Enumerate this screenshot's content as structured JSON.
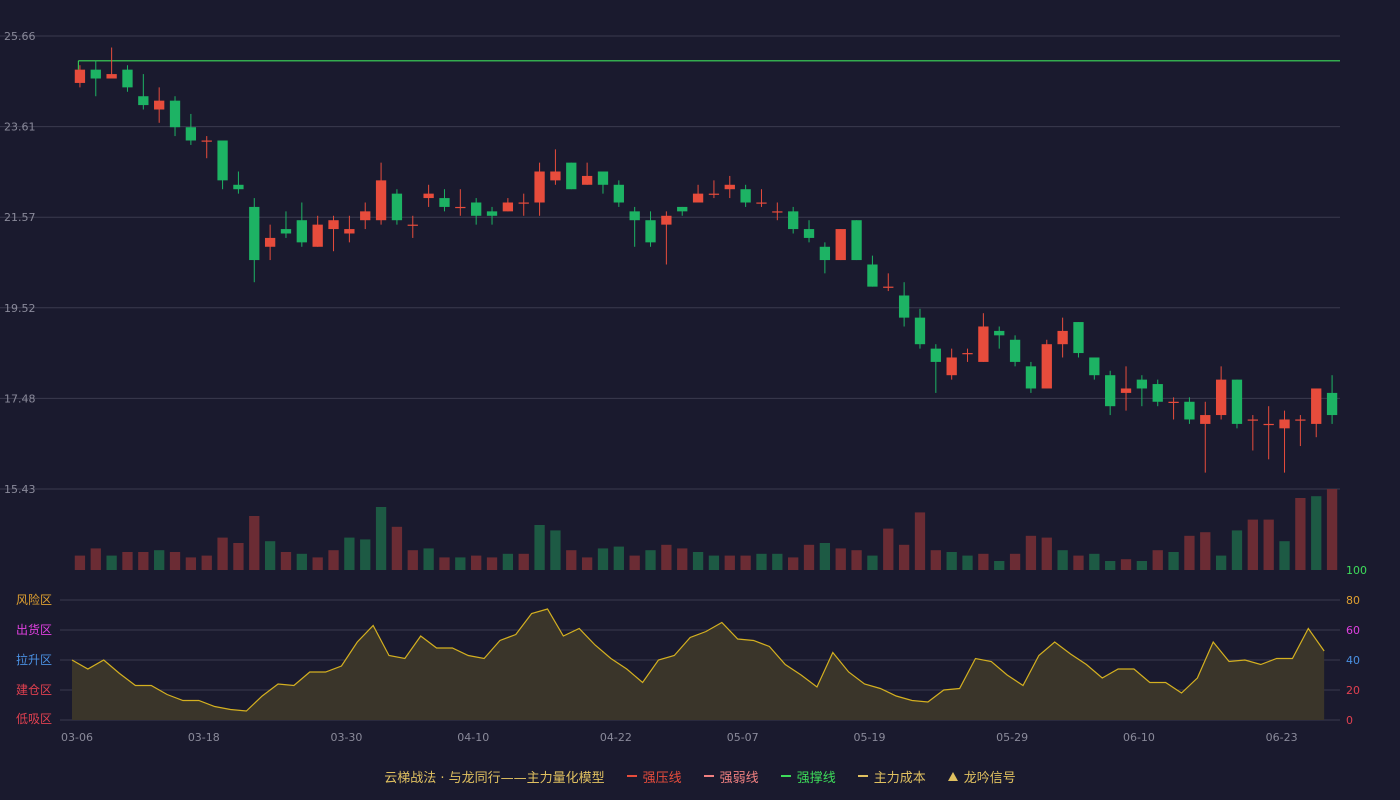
{
  "chart_data": [
    {
      "type": "candlestick",
      "title": "",
      "x_tick_labels": [
        "03-06",
        "03-18",
        "03-30",
        "04-10",
        "04-22",
        "05-07",
        "05-19",
        "05-29",
        "06-10",
        "06-23"
      ],
      "y_tick_labels": [
        "25.66",
        "23.61",
        "21.57",
        "19.52",
        "17.48",
        "15.43"
      ],
      "ylim": [
        15.43,
        25.66
      ],
      "resistance_line": 25.1,
      "colors": {
        "up": "#e74c3c",
        "down": "#1db364",
        "resistance": "#3ddc5a",
        "background": "#1a1a2e",
        "grid": "#3a3a4e"
      },
      "candles": [
        [
          24.6,
          24.9,
          25.0,
          24.5
        ],
        [
          24.9,
          24.7,
          25.1,
          24.3
        ],
        [
          24.7,
          24.8,
          25.4,
          24.7
        ],
        [
          24.9,
          24.5,
          25.0,
          24.4
        ],
        [
          24.3,
          24.1,
          24.8,
          24.0
        ],
        [
          24.0,
          24.2,
          24.5,
          23.7
        ],
        [
          24.2,
          23.6,
          24.3,
          23.4
        ],
        [
          23.6,
          23.3,
          23.9,
          23.2
        ],
        [
          23.3,
          23.3,
          23.4,
          22.9
        ],
        [
          23.3,
          22.4,
          23.3,
          22.2
        ],
        [
          22.3,
          22.2,
          22.6,
          22.1
        ],
        [
          21.8,
          20.6,
          22.0,
          20.1
        ],
        [
          20.9,
          21.1,
          21.4,
          20.6
        ],
        [
          21.3,
          21.2,
          21.7,
          21.1
        ],
        [
          21.5,
          21.0,
          21.9,
          20.9
        ],
        [
          20.9,
          21.4,
          21.6,
          20.9
        ],
        [
          21.3,
          21.5,
          21.6,
          20.8
        ],
        [
          21.2,
          21.3,
          21.6,
          21.0
        ],
        [
          21.5,
          21.7,
          21.9,
          21.3
        ],
        [
          21.5,
          22.4,
          22.8,
          21.4
        ],
        [
          22.1,
          21.5,
          22.2,
          21.4
        ],
        [
          21.4,
          21.4,
          21.6,
          21.1
        ],
        [
          22.0,
          22.1,
          22.3,
          21.8
        ],
        [
          22.0,
          21.8,
          22.2,
          21.7
        ],
        [
          21.8,
          21.8,
          22.2,
          21.6
        ],
        [
          21.9,
          21.6,
          22.0,
          21.4
        ],
        [
          21.7,
          21.6,
          21.8,
          21.4
        ],
        [
          21.7,
          21.9,
          22.0,
          21.7
        ],
        [
          21.9,
          21.9,
          22.1,
          21.6
        ],
        [
          21.9,
          22.6,
          22.8,
          21.6
        ],
        [
          22.4,
          22.6,
          23.1,
          22.3
        ],
        [
          22.8,
          22.2,
          22.8,
          22.2
        ],
        [
          22.3,
          22.5,
          22.8,
          22.3
        ],
        [
          22.6,
          22.3,
          22.6,
          22.1
        ],
        [
          22.3,
          21.9,
          22.4,
          21.8
        ],
        [
          21.7,
          21.5,
          21.8,
          20.9
        ],
        [
          21.5,
          21.0,
          21.7,
          20.9
        ],
        [
          21.4,
          21.6,
          21.7,
          20.5
        ],
        [
          21.8,
          21.7,
          21.8,
          21.6
        ],
        [
          21.9,
          22.1,
          22.3,
          21.9
        ],
        [
          22.1,
          22.1,
          22.4,
          22.0
        ],
        [
          22.2,
          22.3,
          22.5,
          22.0
        ],
        [
          22.2,
          21.9,
          22.3,
          21.8
        ],
        [
          21.9,
          21.9,
          22.2,
          21.8
        ],
        [
          21.7,
          21.7,
          21.9,
          21.5
        ],
        [
          21.7,
          21.3,
          21.8,
          21.2
        ],
        [
          21.3,
          21.1,
          21.5,
          21.0
        ],
        [
          20.9,
          20.6,
          21.0,
          20.3
        ],
        [
          20.6,
          21.3,
          21.3,
          20.6
        ],
        [
          21.5,
          20.6,
          21.5,
          20.6
        ],
        [
          20.5,
          20.0,
          20.7,
          20.0
        ],
        [
          20.0,
          20.0,
          20.3,
          19.9
        ],
        [
          19.8,
          19.3,
          20.1,
          19.1
        ],
        [
          19.3,
          18.7,
          19.5,
          18.6
        ],
        [
          18.6,
          18.3,
          18.7,
          17.6
        ],
        [
          18.0,
          18.4,
          18.6,
          17.9
        ],
        [
          18.5,
          18.5,
          18.6,
          18.3
        ],
        [
          18.3,
          19.1,
          19.4,
          18.3
        ],
        [
          19.0,
          18.9,
          19.1,
          18.6
        ],
        [
          18.8,
          18.3,
          18.9,
          18.2
        ],
        [
          18.2,
          17.7,
          18.3,
          17.6
        ],
        [
          17.7,
          18.7,
          18.8,
          17.7
        ],
        [
          18.7,
          19.0,
          19.3,
          18.4
        ],
        [
          19.2,
          18.5,
          19.2,
          18.4
        ],
        [
          18.4,
          18.0,
          18.4,
          17.9
        ],
        [
          18.0,
          17.3,
          18.1,
          17.1
        ],
        [
          17.6,
          17.7,
          18.2,
          17.2
        ],
        [
          17.9,
          17.7,
          18.0,
          17.3
        ],
        [
          17.8,
          17.4,
          17.9,
          17.3
        ],
        [
          17.4,
          17.4,
          17.5,
          17.0
        ],
        [
          17.4,
          17.0,
          17.5,
          16.9
        ],
        [
          16.9,
          17.1,
          17.4,
          15.8
        ],
        [
          17.1,
          17.9,
          18.2,
          17.0
        ],
        [
          17.9,
          16.9,
          17.9,
          16.8
        ],
        [
          17.0,
          17.0,
          17.1,
          16.3
        ],
        [
          16.9,
          16.9,
          17.3,
          16.1
        ],
        [
          16.8,
          17.0,
          17.2,
          15.8
        ],
        [
          17.0,
          17.0,
          17.1,
          16.4
        ],
        [
          16.9,
          17.7,
          17.7,
          16.6
        ],
        [
          17.6,
          17.1,
          18.0,
          16.9
        ]
      ]
    },
    {
      "type": "bar",
      "title": "",
      "values": [
        8,
        12,
        8,
        10,
        10,
        11,
        10,
        7,
        8,
        18,
        15,
        30,
        16,
        10,
        9,
        7,
        11,
        18,
        17,
        35,
        24,
        11,
        12,
        7,
        7,
        8,
        7,
        9,
        9,
        25,
        22,
        11,
        7,
        12,
        13,
        8,
        11,
        14,
        12,
        10,
        8,
        8,
        8,
        9,
        9,
        7,
        14,
        15,
        12,
        11,
        8,
        23,
        14,
        32,
        11,
        10,
        8,
        9,
        5,
        9,
        19,
        18,
        11,
        8,
        9,
        5,
        6,
        5,
        11,
        10,
        19,
        21,
        8,
        22,
        28,
        28,
        16,
        40,
        41,
        45
      ],
      "directions": [
        "u",
        "u",
        "d",
        "u",
        "u",
        "d",
        "u",
        "u",
        "u",
        "u",
        "u",
        "u",
        "d",
        "u",
        "d",
        "u",
        "u",
        "d",
        "d",
        "d",
        "u",
        "u",
        "d",
        "u",
        "d",
        "u",
        "u",
        "d",
        "u",
        "d",
        "d",
        "u",
        "u",
        "d",
        "d",
        "u",
        "d",
        "u",
        "u",
        "d",
        "d",
        "u",
        "u",
        "d",
        "d",
        "u",
        "u",
        "d",
        "u",
        "u",
        "d",
        "u",
        "u",
        "u",
        "u",
        "d",
        "d",
        "u",
        "d",
        "u",
        "u",
        "u",
        "d",
        "u",
        "d",
        "d",
        "u",
        "d",
        "u",
        "d",
        "u",
        "u",
        "d",
        "d",
        "u",
        "u",
        "d",
        "u",
        "d",
        "u",
        "u"
      ],
      "colors": {
        "up": "#6b2c34",
        "down": "#1d5a44",
        "highlight_up": "#8a3a40",
        "highlight_down": "#236e4e"
      }
    },
    {
      "type": "area",
      "title": "",
      "ylim": [
        0,
        100
      ],
      "y_tick_labels": [
        "100",
        "80",
        "60",
        "40",
        "20",
        "0"
      ],
      "zone_labels": [
        "风险区",
        "出货区",
        "拉升区",
        "建仓区",
        "低吸区"
      ],
      "zone_colors": [
        "#e0a030",
        "#e040e0",
        "#4a90e2",
        "#e04050",
        "#e04050"
      ],
      "tick_colors": [
        "#3ddc5a",
        "#e0a030",
        "#e040e0",
        "#4a90e2",
        "#e04050",
        "#e04050"
      ],
      "values": [
        40,
        34,
        40,
        31,
        23,
        23,
        17,
        13,
        13,
        9,
        7,
        6,
        16,
        24,
        23,
        32,
        32,
        36,
        52,
        63,
        43,
        41,
        56,
        48,
        48,
        43,
        41,
        53,
        57,
        71,
        74,
        56,
        61,
        50,
        41,
        34,
        25,
        40,
        43,
        55,
        59,
        65,
        54,
        53,
        49,
        37,
        30,
        22,
        45,
        32,
        24,
        21,
        16,
        13,
        12,
        20,
        21,
        41,
        39,
        30,
        23,
        43,
        52,
        44,
        37,
        28,
        34,
        34,
        25,
        25,
        18,
        28,
        52,
        39,
        40,
        37,
        41,
        41,
        61,
        46
      ],
      "colors": {
        "line": "#d4b020",
        "fill": "#3a352a"
      }
    }
  ],
  "legend": {
    "title": "云梯战法 · 与龙同行——主力量化模型",
    "items": [
      {
        "label": "强压线",
        "color": "#e74c3c",
        "style": "solid"
      },
      {
        "label": "强弱线",
        "color": "#f08080",
        "style": "dashed"
      },
      {
        "label": "强撑线",
        "color": "#3ddc5a",
        "style": "solid"
      },
      {
        "label": "主力成本",
        "color": "#e0c060",
        "style": "dashed"
      },
      {
        "label": "龙吟信号",
        "color": "#e0c060",
        "style": "triangle"
      }
    ]
  }
}
